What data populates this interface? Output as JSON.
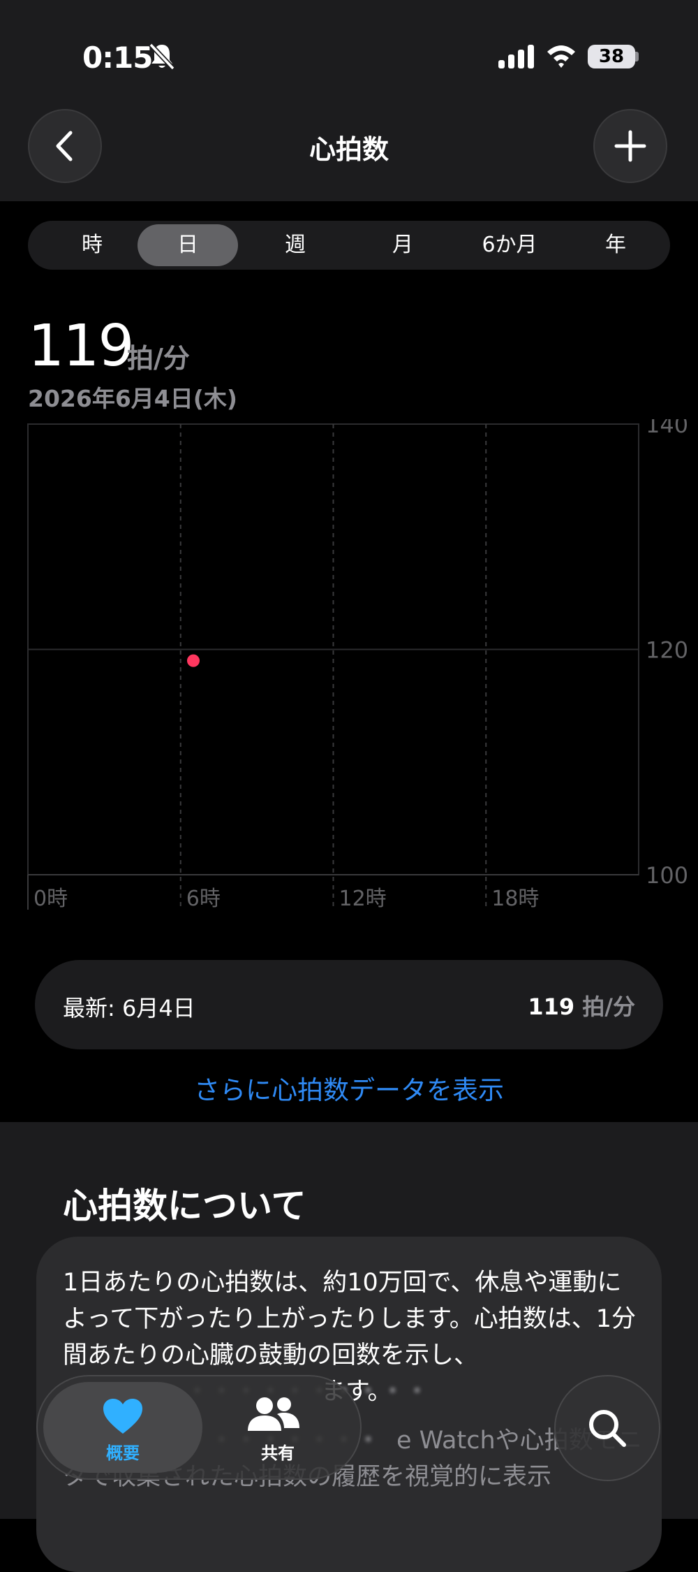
{
  "status_bar": {
    "time": "0:15",
    "battery": "38"
  },
  "nav": {
    "title": "心拍数"
  },
  "segments": [
    "時",
    "日",
    "週",
    "月",
    "6か月",
    "年"
  ],
  "selected_segment": "日",
  "summary": {
    "value": "119",
    "unit": "拍/分",
    "date": "2026年6月4日(木)"
  },
  "chart_data": {
    "type": "scatter",
    "x_unit": "hour",
    "xlim": [
      0,
      24
    ],
    "ylim": [
      100,
      140
    ],
    "x_ticks": [
      0,
      6,
      12,
      18
    ],
    "x_tick_labels": [
      "0時",
      "6時",
      "12時",
      "18時"
    ],
    "y_ticks": [
      100,
      120,
      140
    ],
    "y_tick_labels": [
      "100",
      "120",
      "140"
    ],
    "points": [
      {
        "x": 6.5,
        "y": 119
      }
    ],
    "point_color": "#ff375f",
    "grid": true
  },
  "latest": {
    "label": "最新: 6月4日",
    "value": "119",
    "unit": "拍/分"
  },
  "more_link": "さらに心拍数データを表示",
  "about": {
    "title": "心拍数について",
    "paragraph1": "1日あたりの心拍数は、約10万回で、休息や運動によって下がったり上がったりします。心拍数は、1分間あたりの心臓の鼓動の回数を示し、",
    "paragraph1_tail": "ます。",
    "paragraph2": "e Watchや心拍数モニタで収集された心拍数の履歴を視覚的に表示"
  },
  "tabbar": {
    "summary_label": "概要",
    "sharing_label": "共有"
  },
  "colors": {
    "accent": "#2f8af5",
    "heart": "#30b0ff",
    "point": "#ff375f"
  }
}
